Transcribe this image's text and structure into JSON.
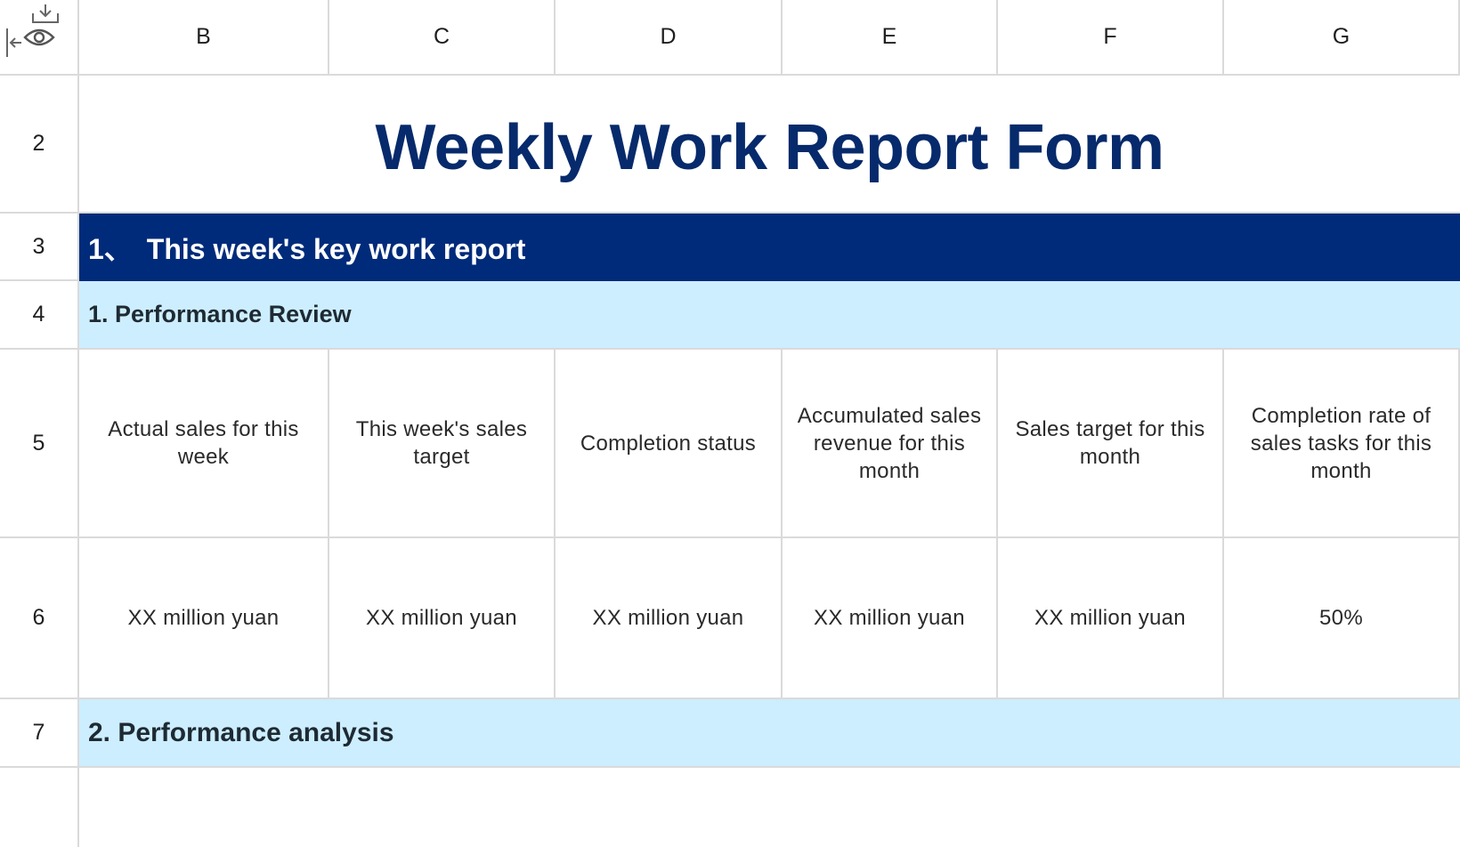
{
  "columns": [
    "B",
    "C",
    "D",
    "E",
    "F",
    "G"
  ],
  "row_numbers": [
    "2",
    "3",
    "4",
    "5",
    "6",
    "7"
  ],
  "title": "Weekly Work Report Form",
  "section_1": "1、　This week's key work report",
  "subsection_1": "1. Performance Review",
  "table_headers": [
    "Actual sales for this week",
    "This week's sales target",
    "Completion status",
    "Accumulated sales revenue for this month",
    "Sales target for this month",
    "Completion rate of sales tasks for this month"
  ],
  "table_values": [
    "XX million yuan",
    "XX million yuan",
    "XX million yuan",
    "XX million yuan",
    "XX million yuan",
    "50%"
  ],
  "subsection_2": "2. Performance analysis",
  "colors": {
    "title": "#062a6b",
    "section_dark": "#002b7a",
    "section_light": "#cdeeff",
    "grid": "#dadada"
  },
  "corner_icons": [
    "collapse-left-icon",
    "eye-icon",
    "download-icon"
  ]
}
